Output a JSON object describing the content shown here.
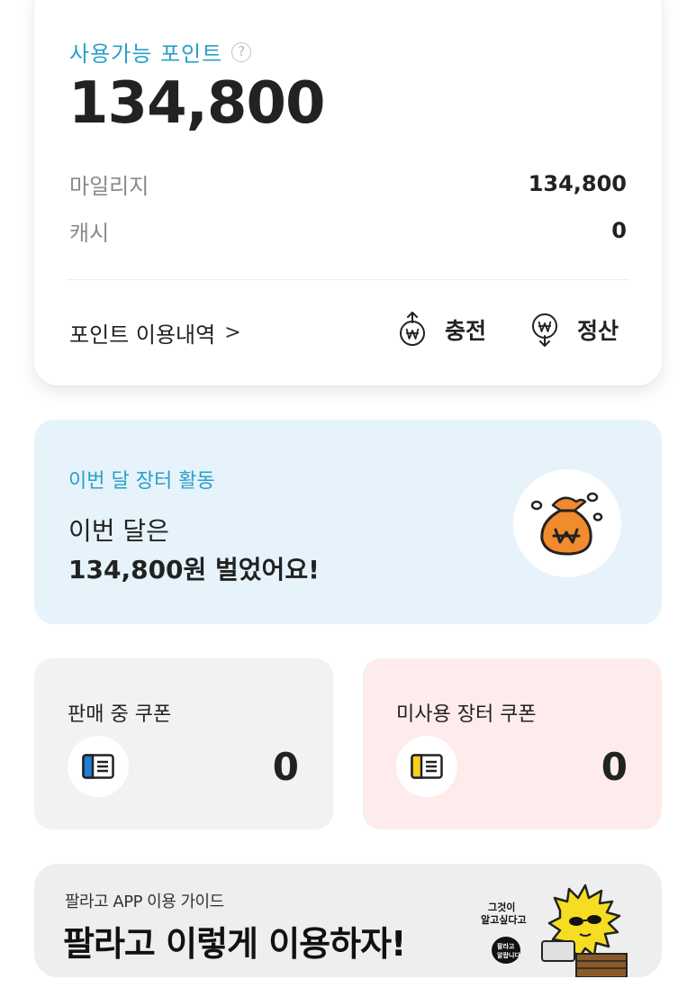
{
  "points": {
    "available_label": "사용가능 포인트",
    "help_glyph": "?",
    "total": "134,800",
    "mileage_label": "마일리지",
    "mileage_value": "134,800",
    "cash_label": "캐시",
    "cash_value": "0",
    "history_link": "포인트 이용내역",
    "history_chevron": ">",
    "charge_label": "충전",
    "settle_label": "정산",
    "accent_color": "#2a9fc8"
  },
  "activity": {
    "title": "이번 달 장터 활동",
    "line1": "이번 달은",
    "line2": "134,800원 벌었어요!",
    "background_color": "#e6f3fb",
    "icon": "money-bag-icon"
  },
  "coupons": [
    {
      "label": "판매 중 쿠폰",
      "count": "0",
      "icon": "coupon-blue-icon",
      "background_color": "#f2f2f3"
    },
    {
      "label": "미사용 장터 쿠폰",
      "count": "0",
      "icon": "coupon-yellow-icon",
      "background_color": "#fdeceb"
    }
  ],
  "guide": {
    "subtitle": "팔라고 APP 이용 가이드",
    "title": "팔라고 이렇게 이용하자!",
    "mascot_caption": "그것이 알고싶다고",
    "mascot_bubble": "팔라고 알랍니다"
  }
}
